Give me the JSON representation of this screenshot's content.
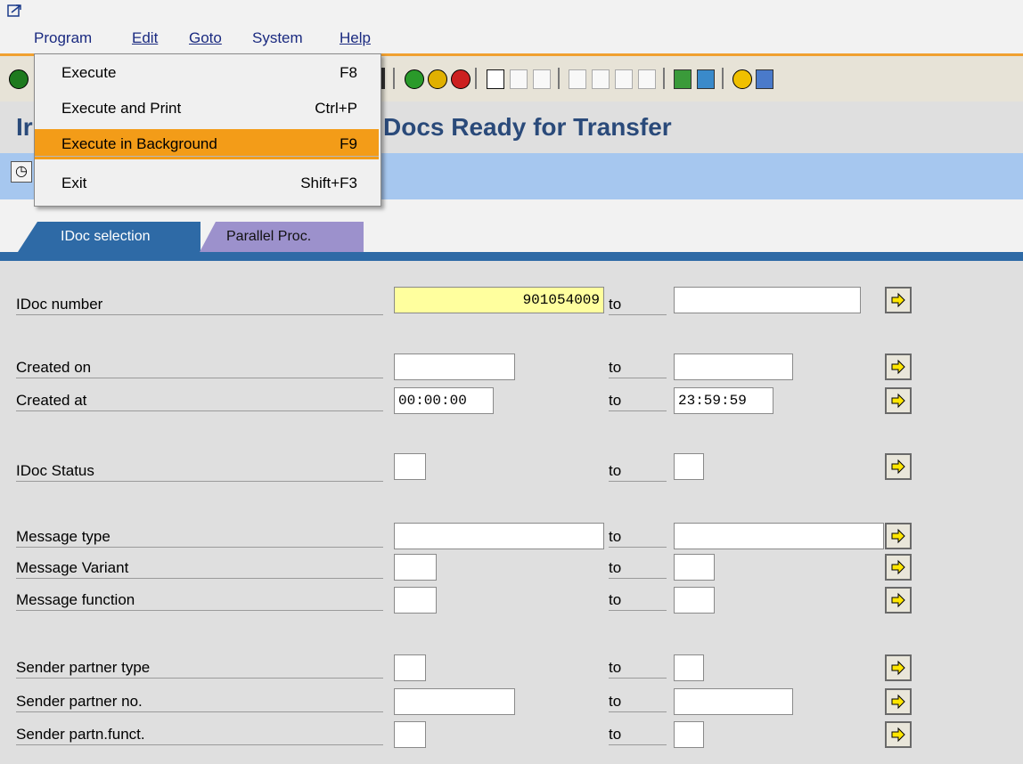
{
  "menubar": {
    "items": [
      {
        "label": "Program"
      },
      {
        "label": "Edit"
      },
      {
        "label": "Goto"
      },
      {
        "label": "System"
      },
      {
        "label": "Help"
      }
    ]
  },
  "dropdown": {
    "items": [
      {
        "label": "Execute",
        "shortcut": "F8",
        "selected": false
      },
      {
        "label": "Execute and Print",
        "shortcut": "Ctrl+P",
        "selected": false
      },
      {
        "label": "Execute in Background",
        "shortcut": "F9",
        "selected": true
      },
      {
        "label": "Exit",
        "shortcut": "Shift+F3",
        "selected": false
      }
    ]
  },
  "title": {
    "left_fragment": "Ir",
    "right_fragment": "Docs Ready for Transfer"
  },
  "tabs": [
    {
      "label": "IDoc selection",
      "active": true
    },
    {
      "label": "Parallel Proc.",
      "active": false
    }
  ],
  "form": {
    "to_label": "to",
    "rows": [
      {
        "label": "IDoc number",
        "from": "901054009",
        "to": ""
      },
      {
        "label": "Created on",
        "from": "",
        "to": ""
      },
      {
        "label": "Created at",
        "from": "00:00:00",
        "to": "23:59:59"
      },
      {
        "label": "IDoc Status",
        "from": "",
        "to": ""
      },
      {
        "label": "Message type",
        "from": "",
        "to": ""
      },
      {
        "label": "Message Variant",
        "from": "",
        "to": ""
      },
      {
        "label": "Message function",
        "from": "",
        "to": ""
      },
      {
        "label": "Sender partner type",
        "from": "",
        "to": ""
      },
      {
        "label": "Sender partner no.",
        "from": "",
        "to": ""
      },
      {
        "label": "Sender partn.funct.",
        "from": "",
        "to": ""
      }
    ]
  },
  "colors": {
    "accent_orange": "#f39c18",
    "tab_active": "#2e6aa6",
    "tab_inactive": "#9c91cc",
    "app_toolbar": "#a6c7ef",
    "highlight_field": "#ffff9e",
    "title_text": "#2a4a7a"
  },
  "icons": [
    "sap-logo-icon",
    "enter-icon",
    "save-icon",
    "back-icon",
    "exit-icon",
    "cancel-icon",
    "print-icon",
    "find-icon",
    "find-next-icon",
    "first-page-icon",
    "previous-page-icon",
    "next-page-icon",
    "last-page-icon",
    "create-session-icon",
    "shortcut-icon",
    "help-icon",
    "layout-icon",
    "execute-background-clock-icon",
    "multiple-selection-arrow-icon"
  ]
}
